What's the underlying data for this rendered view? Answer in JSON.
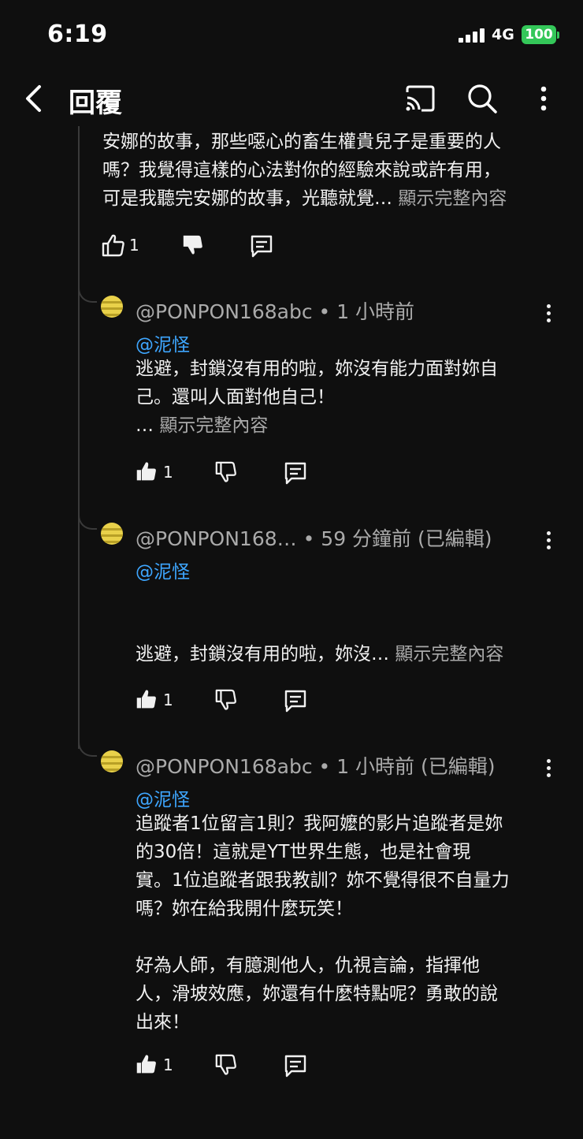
{
  "status_bar": {
    "time": "6:19",
    "network": "4G",
    "battery": "100"
  },
  "header": {
    "title": "回覆",
    "icons": [
      "back-arrow-icon",
      "cast-icon",
      "search-icon",
      "more-vertical-icon"
    ]
  },
  "top_comment": {
    "lines": [
      "安娜的故事，那些噁心的畜生權貴兒子是重要的人",
      "嗎？我覺得這樣的心法對你的經驗來說或許有用，",
      "可是我聽完安娜的故事，光聽就覺…"
    ],
    "show_more": "顯示完整內容",
    "likes": "1"
  },
  "replies": [
    {
      "author": "@PONPON168abc",
      "meta": "• 1 小時前",
      "mention": "@泥怪",
      "lines": [
        "逃避，封鎖沒有用的啦，妳沒有能力面對妳自",
        "己。還叫人面對他自己！"
      ],
      "ellipsis": "…",
      "show_more": "顯示完整內容",
      "likes": "1"
    },
    {
      "author": "@PONPON168…",
      "meta": "• 59 分鐘前 (已編輯)",
      "mention": "@泥怪",
      "lines": [
        "逃避，封鎖沒有用的啦，妳沒…"
      ],
      "show_more": "顯示完整內容",
      "likes": "1"
    },
    {
      "author": "@PONPON168abc",
      "meta": "• 1 小時前 (已編輯)",
      "mention": "@泥怪",
      "lines": [
        "追蹤者1位留言1則？我阿嬤的影片追蹤者是妳",
        "的30倍！這就是YT世界生態，也是社會現",
        "實。1位追蹤者跟我教訓？妳不覺得很不自量力",
        "嗎？妳在給我開什麼玩笑！",
        "",
        "好為人師，有臆測他人，仇視言論，指揮他",
        "人，滑坡效應，妳還有什麼特點呢？勇敢的說",
        "出來！"
      ],
      "likes": "1"
    }
  ]
}
